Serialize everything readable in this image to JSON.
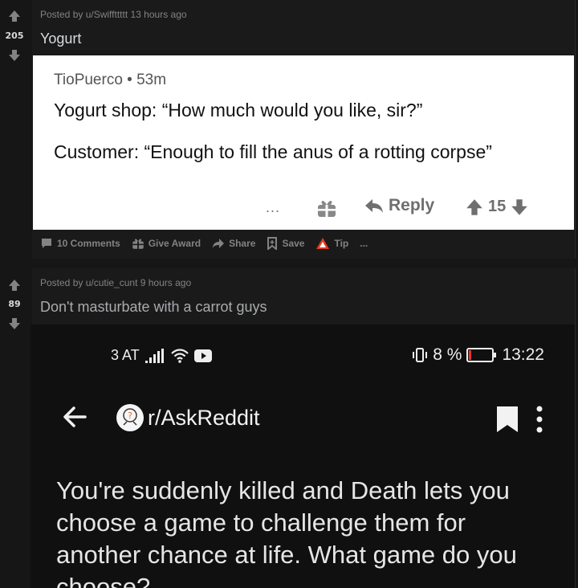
{
  "post1": {
    "score": "205",
    "meta": "Posted by u/Swiffttttt 13 hours ago",
    "title": "Yogurt",
    "image": {
      "author": "TioPuerco • 53m",
      "line1": "Yogurt shop: “How much would you like, sir?”",
      "line2": "Customer: “Enough to fill the anus of a rotting corpse”",
      "dots": "...",
      "reply": "Reply",
      "votes": "15"
    },
    "actions": {
      "comments": "10 Comments",
      "award": "Give Award",
      "share": "Share",
      "save": "Save",
      "tip": "Tip",
      "more": "..."
    }
  },
  "post2": {
    "score": "89",
    "meta": "Posted by u/cutie_cunt 9 hours ago",
    "title": "Don't masturbate with a carrot guys",
    "image": {
      "carrier": "3 AT",
      "battery": "8 %",
      "time": "13:22",
      "subreddit": "r/AskReddit",
      "question": "You're suddenly killed and Death lets you choose a game to challenge them for another chance at life. What game do you choose?"
    }
  },
  "colors": {
    "background": "#1a1a1b",
    "text": "#d7dadc",
    "muted": "#818384",
    "tip_red": "#e03a1e"
  }
}
